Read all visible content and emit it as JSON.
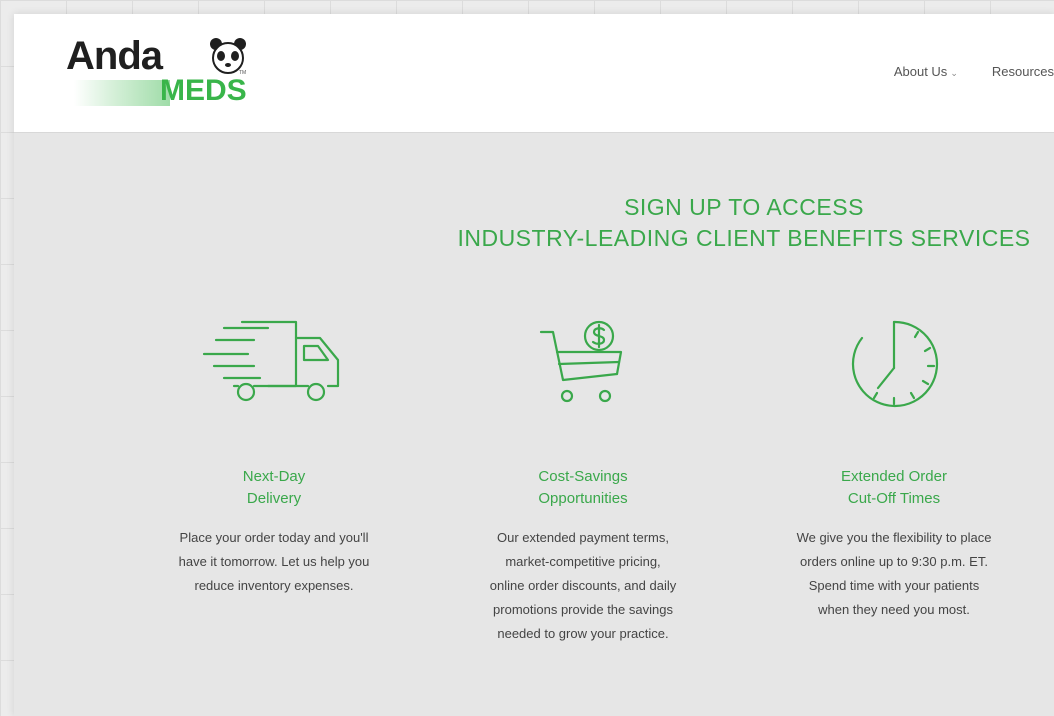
{
  "header": {
    "logo": {
      "top": "Anda",
      "bottom": "MEDS"
    },
    "nav": [
      {
        "label": "About Us",
        "has_dropdown": true
      },
      {
        "label": "Resources",
        "has_dropdown": false
      }
    ]
  },
  "main": {
    "headline_line1": "SIGN UP TO ACCESS",
    "headline_line2": "INDUSTRY-LEADING CLIENT BENEFITS SERVICES",
    "features": [
      {
        "icon": "delivery-truck-icon",
        "title_line1": "Next-Day",
        "title_line2": "Delivery",
        "desc_lines": [
          "Place your order today and you'll",
          "have it tomorrow. Let us help you",
          "reduce inventory expenses."
        ]
      },
      {
        "icon": "cart-dollar-icon",
        "title_line1": "Cost-Savings",
        "title_line2": "Opportunities",
        "desc_lines": [
          "Our extended payment terms,",
          "market-competitive pricing,",
          "online order discounts, and daily",
          "promotions provide the savings",
          "needed to grow your practice."
        ]
      },
      {
        "icon": "clock-icon",
        "title_line1": "Extended Order",
        "title_line2": "Cut-Off Times",
        "desc_lines": [
          "We give you the flexibility to place",
          "orders online up to 9:30 p.m. ET.",
          "Spend time with your patients",
          "when they need you most."
        ]
      }
    ]
  },
  "colors": {
    "accent": "#3aa84b",
    "brand_green": "#39b54a",
    "background": "#e6e6e6"
  }
}
